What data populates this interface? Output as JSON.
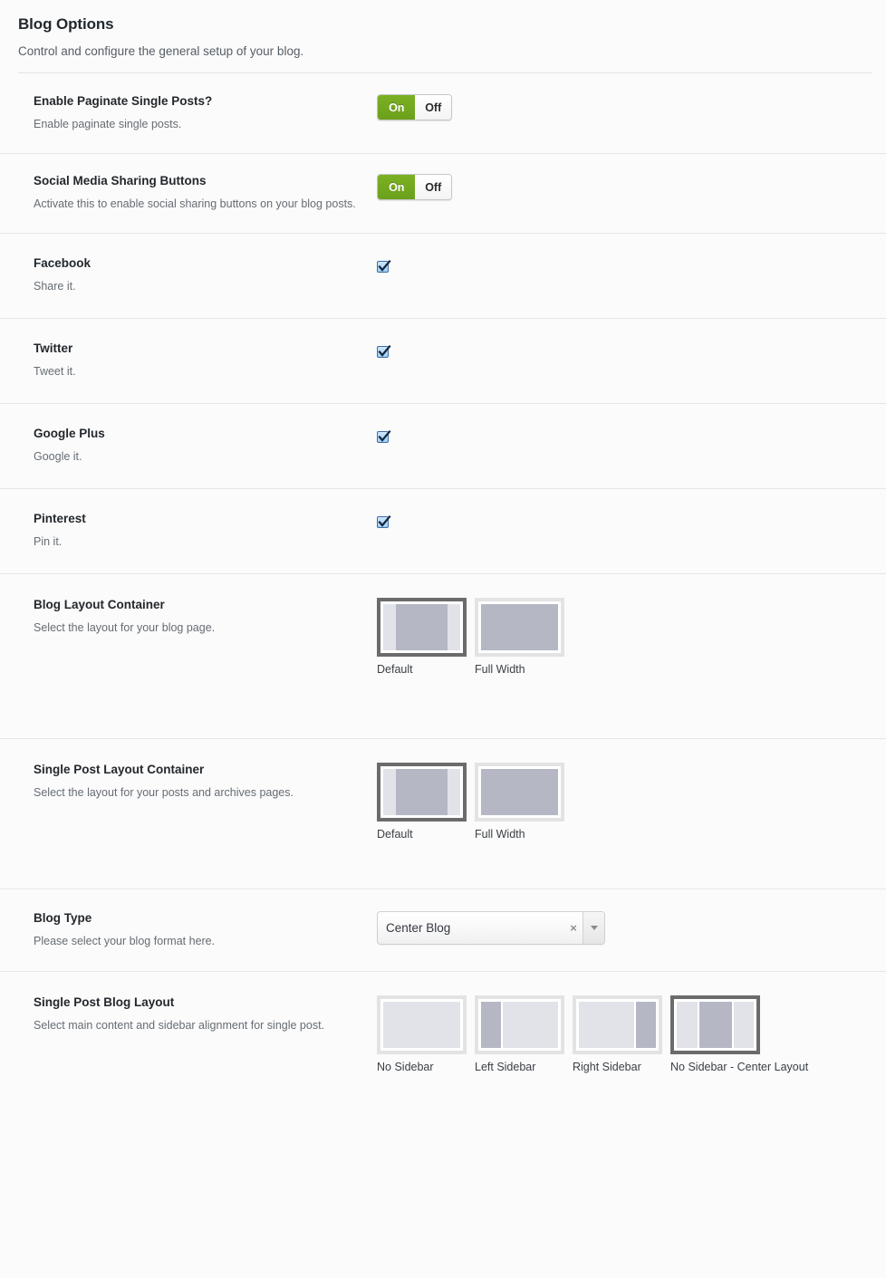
{
  "header": {
    "title": "Blog Options",
    "subtitle": "Control and configure the general setup of your blog."
  },
  "toggle_labels": {
    "on": "On",
    "off": "Off"
  },
  "fields": [
    {
      "title": "Enable Paginate Single Posts?",
      "desc": "Enable paginate single posts.",
      "type": "switch",
      "value": "On"
    },
    {
      "title": "Social Media Sharing Buttons",
      "desc": "Activate this to enable social sharing buttons on your blog posts.",
      "type": "switch",
      "value": "On"
    },
    {
      "title": "Facebook",
      "desc": "Share it.",
      "type": "checkbox",
      "checked": true
    },
    {
      "title": "Twitter",
      "desc": "Tweet it.",
      "type": "checkbox",
      "checked": true
    },
    {
      "title": "Google Plus",
      "desc": "Google it.",
      "type": "checkbox",
      "checked": true
    },
    {
      "title": "Pinterest",
      "desc": "Pin it.",
      "type": "checkbox",
      "checked": true
    },
    {
      "title": "Blog Layout Container",
      "desc": "Select the layout for your blog page.",
      "type": "image-select",
      "options": [
        {
          "label": "Default",
          "selected": true
        },
        {
          "label": "Full Width",
          "selected": false
        }
      ]
    },
    {
      "title": "Single Post Layout Container",
      "desc": "Select the layout for your posts and archives pages.",
      "type": "image-select",
      "options": [
        {
          "label": "Default",
          "selected": true
        },
        {
          "label": "Full Width",
          "selected": false
        }
      ]
    },
    {
      "title": "Blog Type",
      "desc": "Please select your blog format here.",
      "type": "select",
      "value": "Center Blog",
      "clear_icon": "×",
      "arrow_icon": "chevron-down-icon"
    },
    {
      "title": "Single Post Blog Layout",
      "desc": "Select main content and sidebar alignment for single post.",
      "type": "image-select",
      "options": [
        {
          "label": "No Sidebar",
          "selected": false
        },
        {
          "label": "Left Sidebar",
          "selected": false
        },
        {
          "label": "Right Sidebar",
          "selected": false
        },
        {
          "label": "No Sidebar - Center Layout",
          "selected": true
        }
      ]
    }
  ],
  "colors": {
    "toggle_on_green": "#7cb023",
    "page_background": "#fbfbfb",
    "divider": "#e4e6e8",
    "title_text": "#23282d",
    "desc_text": "#666d74",
    "thumb_selected_border": "#6b6b6b",
    "thumb_border": "#e3e3e3",
    "thumb_light_segment": "#e2e3e9",
    "thumb_dark_segment": "#b5b8c4"
  }
}
